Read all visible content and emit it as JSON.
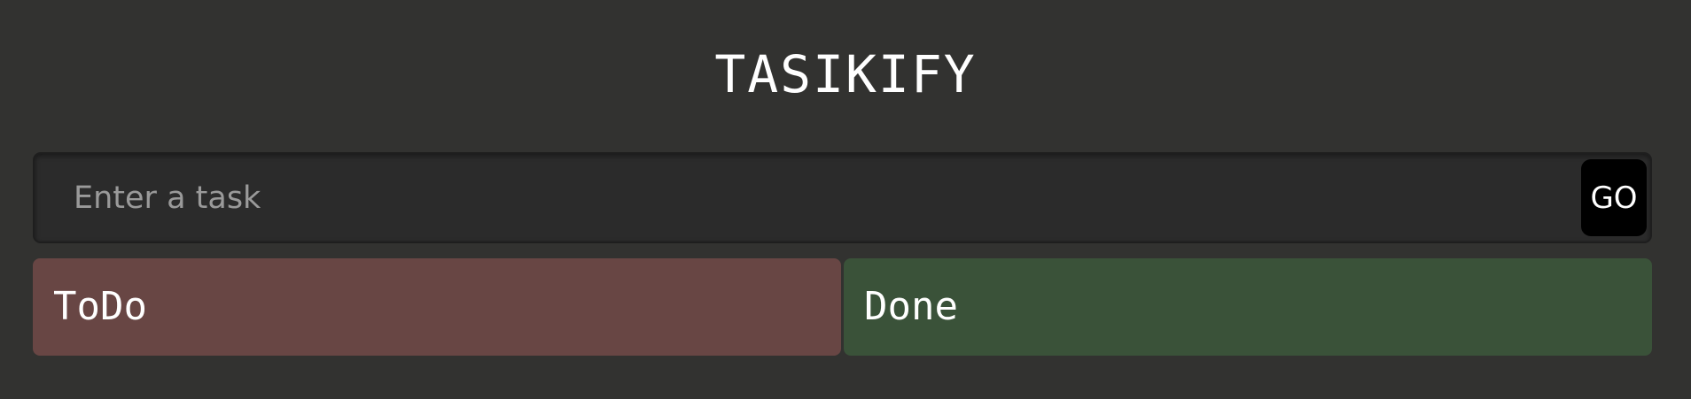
{
  "app": {
    "title": "TASIKIFY"
  },
  "task_form": {
    "input_value": "",
    "input_placeholder": "Enter a task",
    "submit_label": "GO"
  },
  "columns": [
    {
      "label": "ToDo",
      "color": "#684644"
    },
    {
      "label": "Done",
      "color": "#3a5239"
    }
  ],
  "colors": {
    "background": "#323230",
    "input_background": "#2b2b2b",
    "button_background": "#000000",
    "text": "#ffffff"
  }
}
